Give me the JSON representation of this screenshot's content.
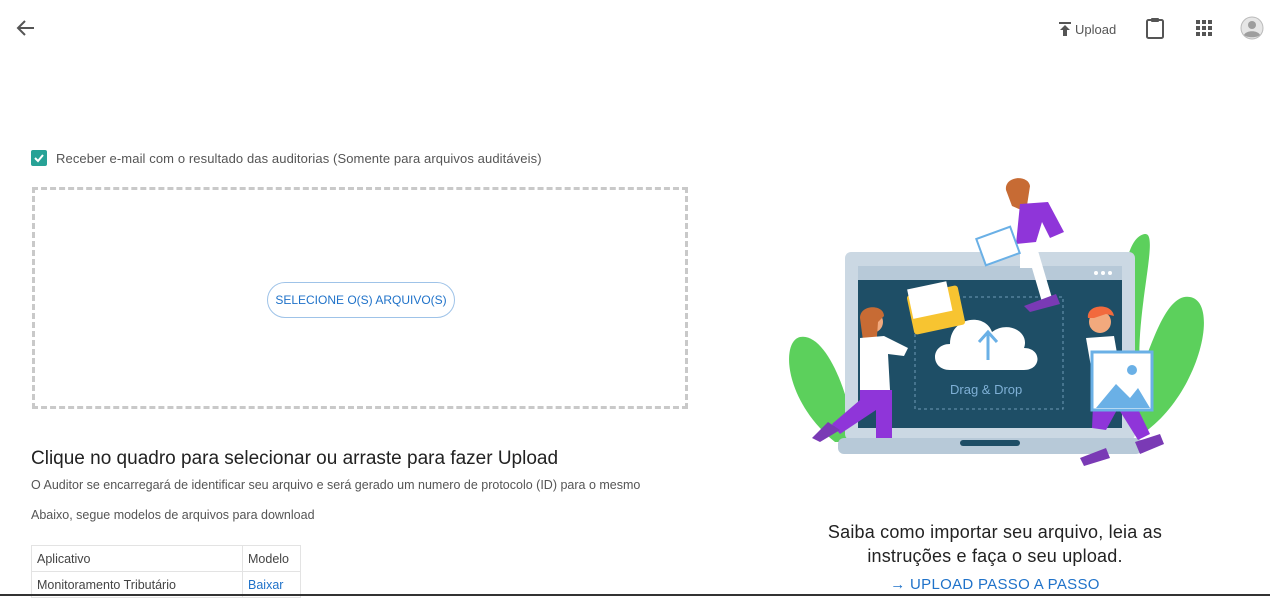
{
  "header": {
    "upload_label": "Upload"
  },
  "form": {
    "email_checkbox_label": "Receber e-mail com o resultado das auditorias (Somente para arquivos auditáveis)",
    "email_checkbox_checked": true,
    "select_files_label": "SELECIONE O(S) ARQUIVO(S)"
  },
  "instructions": {
    "title": "Clique no quadro para selecionar ou arraste para fazer Upload",
    "description": "O Auditor se encarregará de identificar seu arquivo e será gerado um numero de protocolo (ID) para o mesmo",
    "models_note": "Abaixo, segue modelos de arquivos para download"
  },
  "models_table": {
    "headers": [
      "Aplicativo",
      "Modelo"
    ],
    "rows": [
      {
        "app": "Monitoramento Tributário",
        "model": "Baixar"
      }
    ]
  },
  "illustration": {
    "drag_drop_label": "Drag & Drop"
  },
  "side": {
    "text_line1": "Saiba como importar seu arquivo, leia as",
    "text_line2": "instruções e faça o seu upload.",
    "step_link": "→ UPLOAD PASSO A PASSO"
  },
  "colors": {
    "accent": "#27a296",
    "link": "#1f72c9",
    "purple": "#8f35d9",
    "yellow": "#f7c431",
    "screen": "#1e4e66",
    "leaf": "#5cd05c"
  }
}
